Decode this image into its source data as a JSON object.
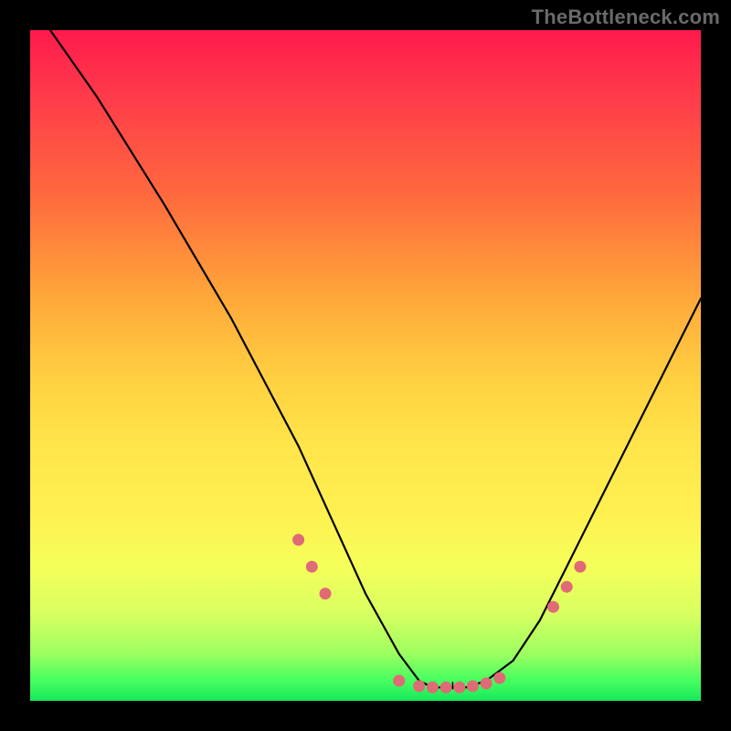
{
  "watermark": "TheBottleneck.com",
  "chart_data": {
    "type": "line",
    "title": "",
    "xlabel": "",
    "ylabel": "",
    "xlim": [
      0,
      100
    ],
    "ylim": [
      0,
      100
    ],
    "series": [
      {
        "name": "curve",
        "x": [
          3,
          10,
          20,
          30,
          40,
          45,
          50,
          55,
          58,
          60,
          62,
          65,
          68,
          72,
          76,
          80,
          85,
          90,
          95,
          100
        ],
        "y": [
          100,
          90,
          74,
          57,
          38,
          27,
          16,
          7,
          3,
          2,
          2,
          2,
          3,
          6,
          12,
          20,
          30,
          40,
          50,
          60
        ]
      }
    ],
    "markers": {
      "name": "highlight-points",
      "color": "#e06a75",
      "x": [
        40,
        42,
        44,
        55,
        58,
        60,
        62,
        64,
        66,
        68,
        70,
        78,
        80,
        82
      ],
      "y": [
        24,
        20,
        16,
        3,
        2.2,
        2,
        2,
        2,
        2.2,
        2.6,
        3.4,
        14,
        17,
        20
      ]
    },
    "gradient_stops": [
      {
        "pos": 0,
        "color": "#ff1a4d"
      },
      {
        "pos": 25,
        "color": "#ff6b3d"
      },
      {
        "pos": 52,
        "color": "#ffd040"
      },
      {
        "pos": 80,
        "color": "#f5ff5a"
      },
      {
        "pos": 100,
        "color": "#17e85a"
      }
    ]
  }
}
